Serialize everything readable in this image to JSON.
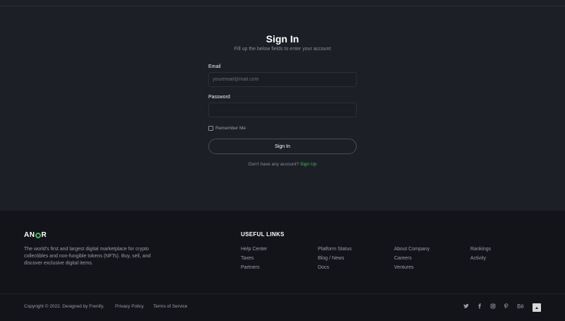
{
  "signin": {
    "title": "Sign In",
    "subtitle": "Fill up the below fields to enter your account",
    "email_label": "Email",
    "email_placeholder": "youremail@mail.com",
    "email_value": "",
    "password_label": "Password",
    "password_value": "",
    "remember_label": "Remember Me",
    "remember_checked": false,
    "submit_label": "Sign In",
    "signup_prompt": "Don't have any account?",
    "signup_link": "Sign Up"
  },
  "footer": {
    "logo_left": "AN",
    "logo_right": "R",
    "about": "The world's first and largest digital marketplace for crypto collectibles and non-fungible tokens (NFTs). Buy, sell, and discover exclusive digital items.",
    "useful_links_title": "USEFUL LINKS",
    "links": [
      [
        "Help Center",
        "Taxes",
        "Partners"
      ],
      [
        "Platform Status",
        "Blog / News",
        "Docs"
      ],
      [
        "About Company",
        "Careers",
        "Ventures"
      ],
      [
        "Rankings",
        "Activity"
      ]
    ],
    "copyright": "Copyright © 2022. Designed by Frenify.",
    "privacy": "Privacy Policy",
    "terms": "Terms of Service",
    "social_icons": [
      "twitter-icon",
      "facebook-icon",
      "instagram-icon",
      "pinterest-icon",
      "behance-icon"
    ],
    "behance_text": "Bē"
  },
  "colors": {
    "accent": "#3fbf5a",
    "background": "#1d1f26",
    "footer_background": "#13141a"
  }
}
